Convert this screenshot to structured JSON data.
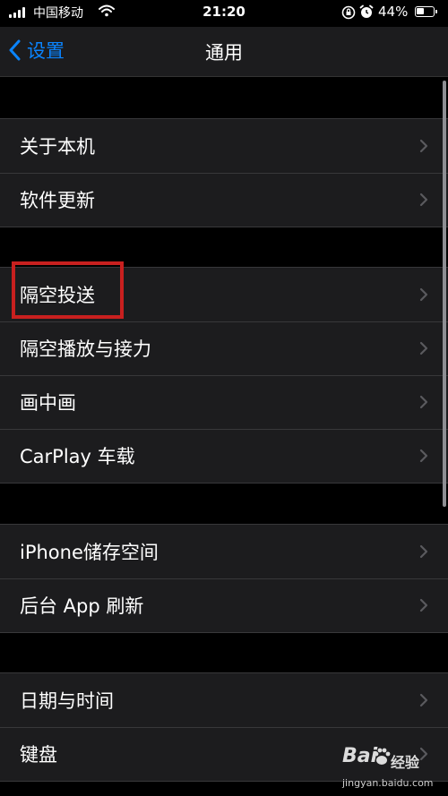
{
  "status_bar": {
    "carrier": "中国移动",
    "time": "21:20",
    "battery_percent": "44%",
    "battery_level": 0.44,
    "icons": [
      "signal-icon",
      "wifi-icon",
      "orientation-lock-icon",
      "alarm-icon",
      "battery-icon"
    ]
  },
  "nav": {
    "back_label": "设置",
    "title": "通用"
  },
  "groups": [
    {
      "items": [
        {
          "label": "关于本机"
        },
        {
          "label": "软件更新"
        }
      ]
    },
    {
      "items": [
        {
          "label": "隔空投送"
        },
        {
          "label": "隔空播放与接力"
        },
        {
          "label": "画中画"
        },
        {
          "label": "CarPlay 车载"
        }
      ]
    },
    {
      "items": [
        {
          "label": "iPhone储存空间"
        },
        {
          "label": "后台 App 刷新"
        }
      ]
    },
    {
      "items": [
        {
          "label": "日期与时间"
        },
        {
          "label": "键盘"
        }
      ]
    }
  ],
  "highlighted_item": "隔空投送",
  "colors": {
    "accent": "#0a84ff",
    "highlight": "#c8201f",
    "background": "#000000",
    "cell": "#1c1c1e"
  },
  "watermark": {
    "logo_left": "Bai",
    "logo_right": "经验",
    "url": "jingyan.baidu.com"
  }
}
